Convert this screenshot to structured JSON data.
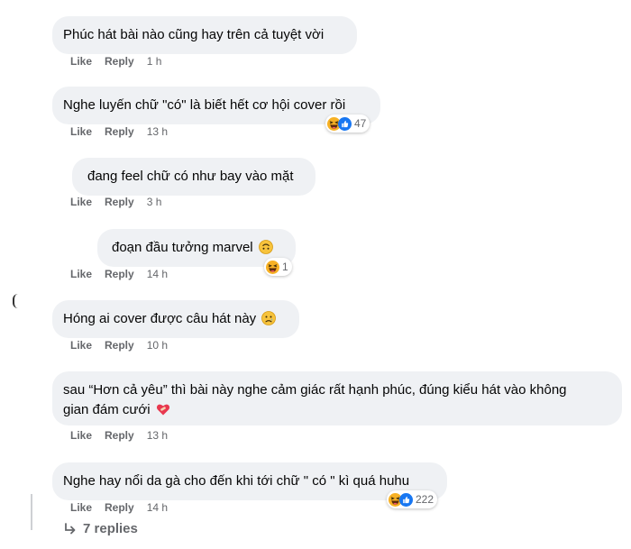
{
  "comments": [
    {
      "text": "Phúc hát bài nào cũng hay trên cả tuyệt vời",
      "like": "Like",
      "reply": "Reply",
      "time": "1 h"
    },
    {
      "text": "Nghe luyến chữ \"có\" là biết hết cơ hội cover rồi",
      "like": "Like",
      "reply": "Reply",
      "time": "13 h",
      "reaction_count": "47",
      "reactions": [
        "haha-icon",
        "like-icon"
      ]
    },
    {
      "text": "đang feel chữ có như bay vào mặt",
      "like": "Like",
      "reply": "Reply",
      "time": "3 h"
    },
    {
      "text": "đoạn đầu tưởng marvel",
      "emoji": "upside-down-face-icon",
      "like": "Like",
      "reply": "Reply",
      "time": "14 h",
      "reaction_count": "1",
      "reactions": [
        "haha-icon"
      ]
    },
    {
      "text": "Hóng ai cover được câu hát này",
      "emoji": "sad-face-icon",
      "like": "Like",
      "reply": "Reply",
      "time": "10 h"
    },
    {
      "text_line1": "sau “Hơn cả yêu” thì bài này nghe cảm giác rất hạnh phúc, đúng kiểu hát vào không",
      "text_line2": "gian đám cưới",
      "emoji": "heart-bandage-icon",
      "like": "Like",
      "reply": "Reply",
      "time": "13 h"
    },
    {
      "text": "Nghe hay nổi da gà cho đến khi tới chữ \" có \" kì quá huhu",
      "like": "Like",
      "reply": "Reply",
      "time": "14 h",
      "reaction_count": "222",
      "reactions": [
        "haha-icon",
        "like-icon"
      ]
    }
  ],
  "replies_label": "7 replies",
  "colors": {
    "bubble": "#eff1f4",
    "muted": "#65676b",
    "like_blue": "#1877f2",
    "haha_yellow": "#f7b125"
  }
}
